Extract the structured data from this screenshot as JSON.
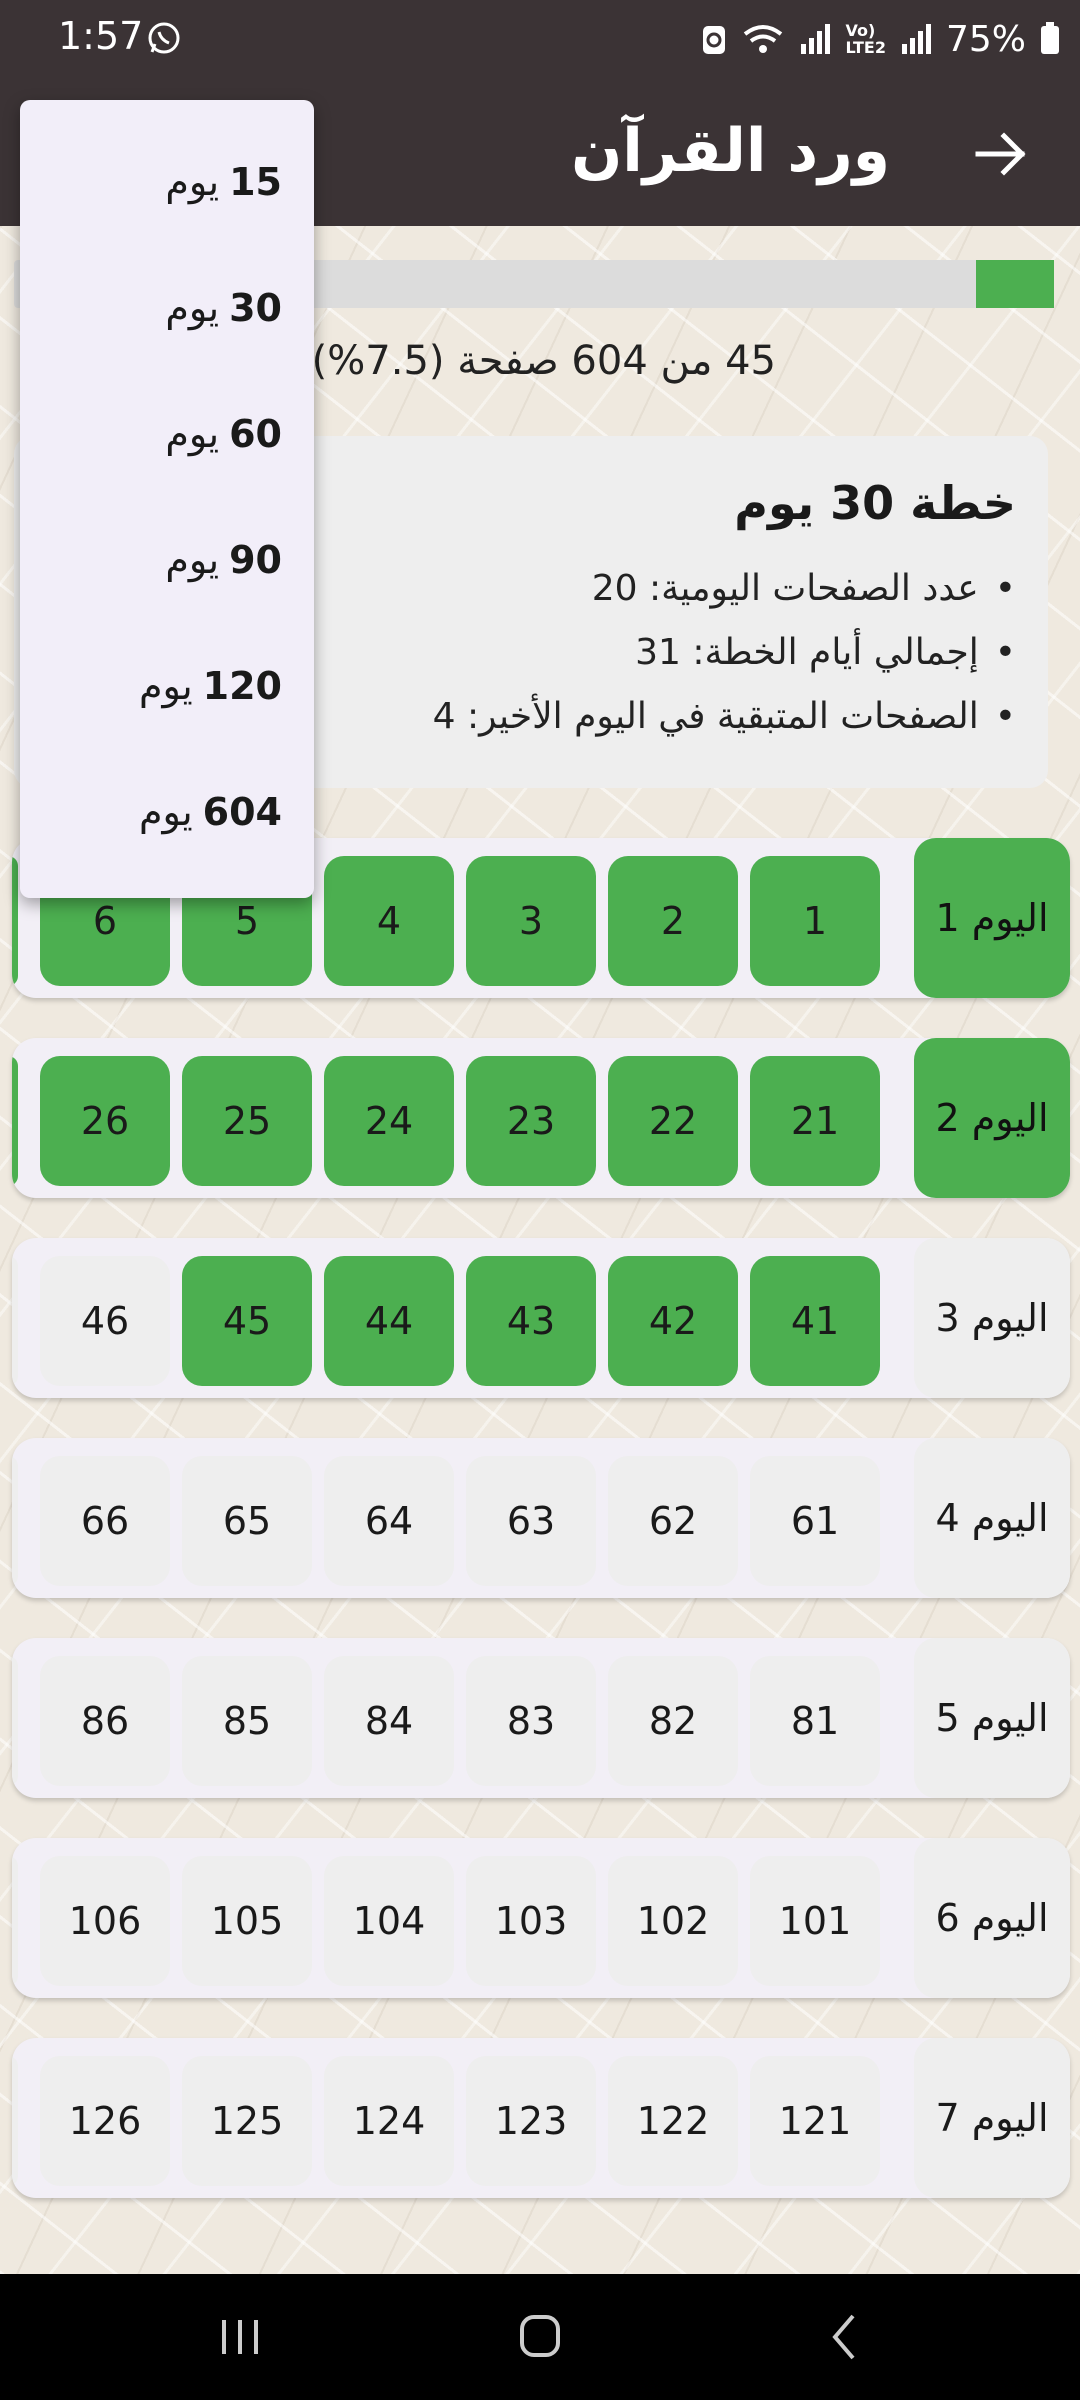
{
  "status": {
    "time": "1:57",
    "battery": "75%",
    "network_label_1": "Vo)",
    "network_label_2": "LTE2"
  },
  "header": {
    "title": "ورد القرآن"
  },
  "progress": {
    "fraction": 0.075,
    "text": "45 من 604 صفحة (7.5%)"
  },
  "plan": {
    "title": "خطة 30 يوم",
    "lines": [
      "عدد الصفحات اليومية: 20",
      "إجمالي أيام الخطة: 31",
      "الصفحات المتبقية في اليوم الأخير: 4"
    ]
  },
  "days": [
    {
      "label": "اليوم 1",
      "done": true,
      "pages": [
        "1",
        "2",
        "3",
        "4",
        "5",
        "6"
      ],
      "done_pages": 6
    },
    {
      "label": "اليوم 2",
      "done": true,
      "pages": [
        "21",
        "22",
        "23",
        "24",
        "25",
        "26"
      ],
      "done_pages": 6
    },
    {
      "label": "اليوم 3",
      "done": false,
      "pages": [
        "41",
        "42",
        "43",
        "44",
        "45",
        "46"
      ],
      "done_pages": 5
    },
    {
      "label": "اليوم 4",
      "done": false,
      "pages": [
        "61",
        "62",
        "63",
        "64",
        "65",
        "66"
      ],
      "done_pages": 0
    },
    {
      "label": "اليوم 5",
      "done": false,
      "pages": [
        "81",
        "82",
        "83",
        "84",
        "85",
        "86"
      ],
      "done_pages": 0
    },
    {
      "label": "اليوم 6",
      "done": false,
      "pages": [
        "101",
        "102",
        "103",
        "104",
        "105",
        "106"
      ],
      "done_pages": 0
    },
    {
      "label": "اليوم 7",
      "done": false,
      "pages": [
        "121",
        "122",
        "123",
        "124",
        "125",
        "126"
      ],
      "done_pages": 0
    }
  ],
  "dropdown": {
    "unit": "يوم",
    "options": [
      "15",
      "30",
      "60",
      "90",
      "120",
      "604"
    ]
  },
  "colors": {
    "bar": "#3b3335",
    "done": "#4caf50",
    "cell": "#eeeeee"
  }
}
